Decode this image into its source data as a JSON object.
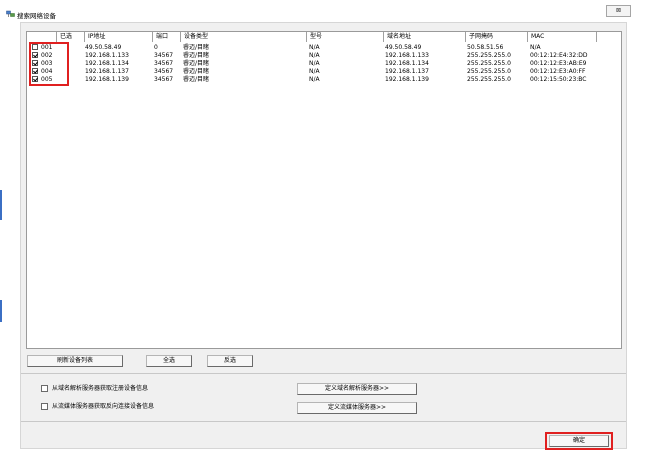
{
  "window": {
    "title": "搜索网络设备",
    "close_label": "⊠"
  },
  "table": {
    "columns": [
      "已选",
      "IP地址",
      "端口",
      "设备类型",
      "型号",
      "域名地址",
      "子网掩码",
      "MAC"
    ],
    "rows": [
      {
        "checked": false,
        "id": "001",
        "ip": "49.50.58.49",
        "port": "0",
        "type": "睿迈/目睹",
        "model": "N/A",
        "domain": "49.50.58.49",
        "mask": "50.58.51.56",
        "mac": "N/A"
      },
      {
        "checked": true,
        "id": "002",
        "ip": "192.168.1.133",
        "port": "34567",
        "type": "睿迈/目睹",
        "model": "N/A",
        "domain": "192.168.1.133",
        "mask": "255.255.255.0",
        "mac": "00:12:12:E4:32:DD"
      },
      {
        "checked": true,
        "id": "003",
        "ip": "192.168.1.134",
        "port": "34567",
        "type": "睿迈/目睹",
        "model": "N/A",
        "domain": "192.168.1.134",
        "mask": "255.255.255.0",
        "mac": "00:12:12:E3:AB:E9"
      },
      {
        "checked": true,
        "id": "004",
        "ip": "192.168.1.137",
        "port": "34567",
        "type": "睿迈/目睹",
        "model": "N/A",
        "domain": "192.168.1.137",
        "mask": "255.255.255.0",
        "mac": "00:12:12:E3:A0:FF"
      },
      {
        "checked": true,
        "id": "005",
        "ip": "192.168.1.139",
        "port": "34567",
        "type": "睿迈/目睹",
        "model": "N/A",
        "domain": "192.168.1.139",
        "mask": "255.255.255.0",
        "mac": "00:12:15:50:23:BC"
      }
    ]
  },
  "buttons": {
    "refresh": "刷新设备列表",
    "select_all": "全选",
    "invert": "反选",
    "define_dns": "定义域名解析服务器>>",
    "define_stream": "定义流媒体服务器>>",
    "ok": "确定"
  },
  "options": {
    "from_dns": "从域名解析服务器获取注册设备信息",
    "from_stream": "从流媒体服务器获取反向连接设备信息"
  },
  "colors": {
    "highlight": "#e02020"
  }
}
